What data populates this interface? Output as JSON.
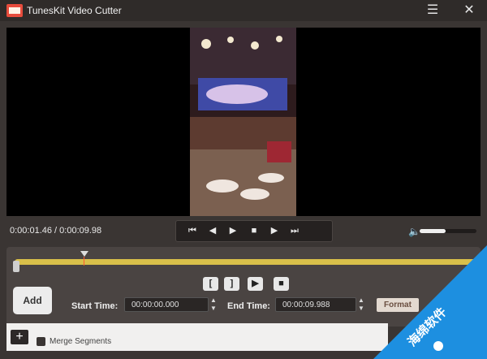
{
  "window": {
    "title": "TunesKit Video Cutter"
  },
  "titlebar_buttons": {
    "menu_icon": "menu-icon",
    "close_icon": "close-icon"
  },
  "playback": {
    "current_time": "0:00:01.46 / 0:00:09.98",
    "volume_fraction": 0.45
  },
  "transport_icons": [
    "skip-start-icon",
    "step-back-icon",
    "play-icon",
    "stop-icon",
    "step-forward-icon",
    "skip-end-icon"
  ],
  "segment_buttons": [
    {
      "label": "["
    },
    {
      "label": "]"
    },
    {
      "label": "▶"
    },
    {
      "label": "■"
    }
  ],
  "cut": {
    "add_label": "Add",
    "start_label": "Start Time:",
    "start_value": "00:00:00.000",
    "end_label": "End Time:",
    "end_value": "00:00:09.988",
    "format_label": "Format",
    "merge_label": "Merge Segments",
    "merge_checked": false,
    "plus_label": "+"
  },
  "watermark": {
    "text": "海绵软件"
  },
  "colors": {
    "accent": "#e6c74e",
    "watermark": "#1d8fe0"
  }
}
